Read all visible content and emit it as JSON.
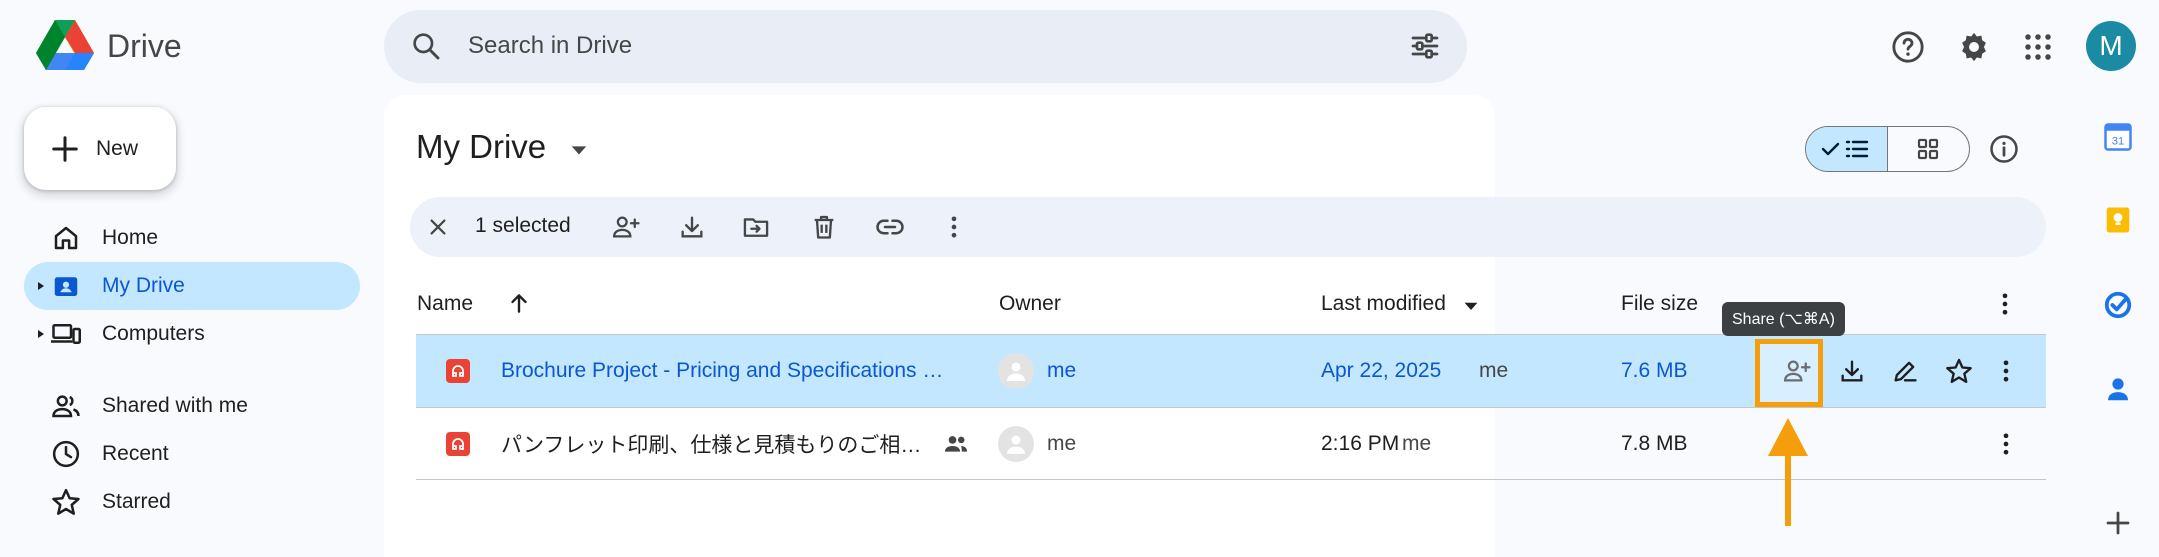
{
  "app": {
    "name": "Drive"
  },
  "search": {
    "placeholder": "Search in Drive"
  },
  "header": {
    "avatar_letter": "M"
  },
  "sidebar": {
    "new_label": "New",
    "items": [
      {
        "label": "Home"
      },
      {
        "label": "My Drive"
      },
      {
        "label": "Computers"
      },
      {
        "label": "Shared with me"
      },
      {
        "label": "Recent"
      },
      {
        "label": "Starred"
      }
    ]
  },
  "main": {
    "title": "My Drive",
    "selection": {
      "text": "1 selected"
    },
    "columns": {
      "name": "Name",
      "owner": "Owner",
      "last_modified": "Last modified",
      "file_size": "File size"
    },
    "files": [
      {
        "name": "Brochure Project - Pricing and Specifications …",
        "owner": "me",
        "modified_date": "Apr 22, 2025",
        "modified_by": "me",
        "size": "7.6 MB",
        "selected": true,
        "shared": false
      },
      {
        "name": "パンフレット印刷、仕様と見積もりのご相…",
        "owner": "me",
        "modified_date": "2:16 PM",
        "modified_by": "me",
        "size": "7.8 MB",
        "selected": false,
        "shared": true
      }
    ],
    "tooltip": "Share (⌥⌘A)"
  },
  "colors": {
    "accent": "#0b57d0",
    "selected_bg": "#c2e7ff",
    "highlight": "#f59e0b",
    "pdf_red": "#ea4335"
  }
}
